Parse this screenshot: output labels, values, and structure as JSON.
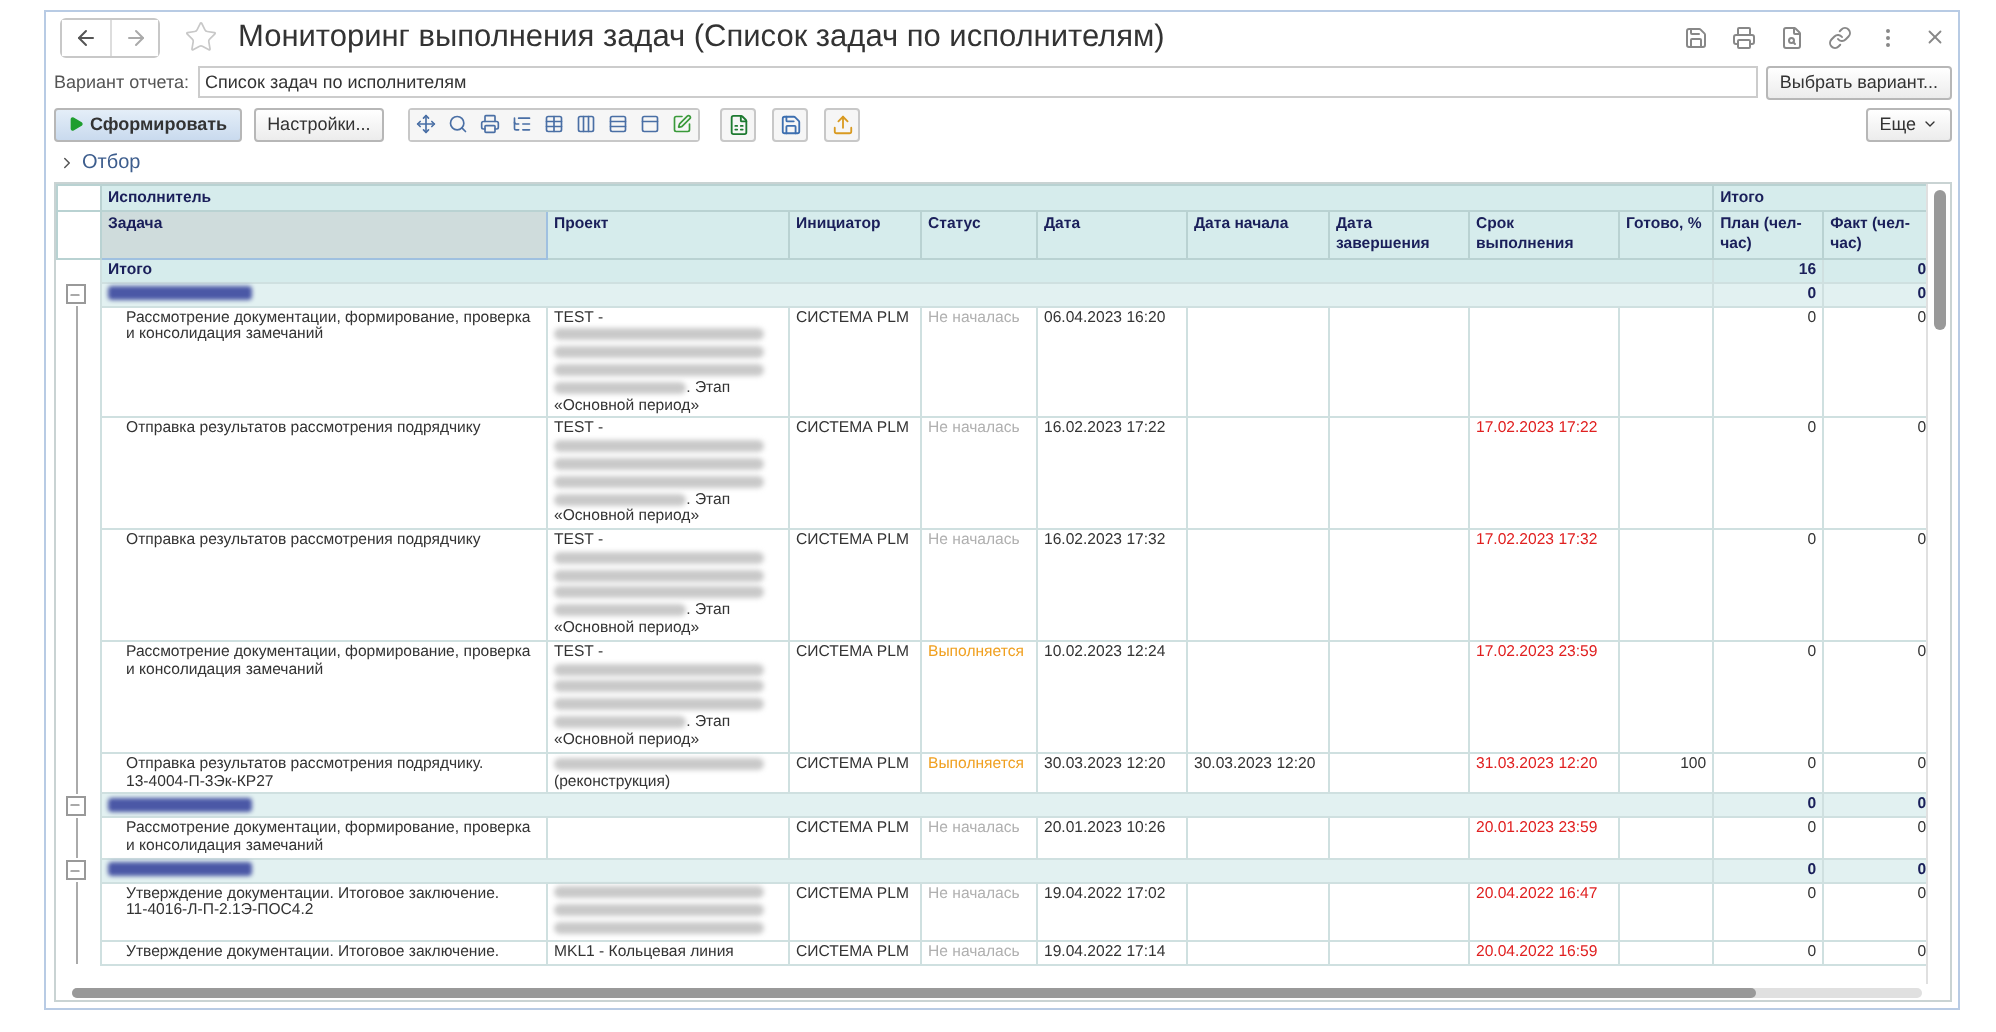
{
  "window": {
    "title": "Мониторинг выполнения задач (Список задач по исполнителям)"
  },
  "variant": {
    "label": "Вариант отчета:",
    "value": "Список задач по исполнителям",
    "button": "Выбрать вариант..."
  },
  "toolbar": {
    "generate": "Сформировать",
    "settings": "Настройки...",
    "more": "Еще"
  },
  "filter": {
    "label": "Отбор",
    "expanded": false
  },
  "table": {
    "group_header": "Исполнитель",
    "totals_header": "Итого",
    "columns": [
      "Задача",
      "Проект",
      "Инициатор",
      "Статус",
      "Дата",
      "Дата начала",
      "Дата завершения",
      "Срок выполнения",
      "Готово, %",
      "План (чел-час)",
      "Факт (чел-час)"
    ],
    "total": {
      "label": "Итого",
      "plan": "16",
      "fact": "0"
    },
    "rows": [
      {
        "kind": "group",
        "expanded": true,
        "plan": "0",
        "fact": "0"
      },
      {
        "kind": "task",
        "task": "Рассмотрение документации, формирование, проверка и консолидация замечаний",
        "project": [
          [
            {
              "kind": "text",
              "text": "TEST -"
            }
          ],
          [
            {
              "kind": "redacted"
            }
          ],
          [
            {
              "kind": "redacted"
            }
          ],
          [
            {
              "kind": "redacted"
            }
          ],
          [
            {
              "kind": "redacted"
            },
            {
              "kind": "text",
              "text": ". Этап"
            }
          ],
          [
            {
              "kind": "text",
              "text": "«Основной период»"
            }
          ]
        ],
        "initiator": "СИСТЕМА PLM",
        "status": {
          "kind": "not_started",
          "text": "Не началась"
        },
        "date": "06.04.2023 16:20",
        "plan": "0",
        "fact": "0"
      },
      {
        "kind": "task",
        "task": "Отправка результатов рассмотрения подрядчику",
        "project": [
          [
            {
              "kind": "text",
              "text": "TEST -"
            }
          ],
          [
            {
              "kind": "redacted"
            }
          ],
          [
            {
              "kind": "redacted"
            }
          ],
          [
            {
              "kind": "redacted"
            }
          ],
          [
            {
              "kind": "redacted"
            },
            {
              "kind": "text",
              "text": ". Этап"
            }
          ],
          [
            {
              "kind": "text",
              "text": "«Основной период»"
            }
          ]
        ],
        "initiator": "СИСТЕМА PLM",
        "status": {
          "kind": "not_started",
          "text": "Не началась"
        },
        "date": "16.02.2023 17:22",
        "deadline": {
          "text": "17.02.2023 17:22",
          "overdue": true
        },
        "plan": "0",
        "fact": "0"
      },
      {
        "kind": "task",
        "task": "Отправка результатов рассмотрения подрядчику",
        "project": [
          [
            {
              "kind": "text",
              "text": "TEST -"
            }
          ],
          [
            {
              "kind": "redacted"
            }
          ],
          [
            {
              "kind": "redacted"
            }
          ],
          [
            {
              "kind": "redacted"
            }
          ],
          [
            {
              "kind": "redacted"
            },
            {
              "kind": "text",
              "text": ". Этап"
            }
          ],
          [
            {
              "kind": "text",
              "text": "«Основной период»"
            }
          ]
        ],
        "initiator": "СИСТЕМА PLM",
        "status": {
          "kind": "not_started",
          "text": "Не началась"
        },
        "date": "16.02.2023 17:32",
        "deadline": {
          "text": "17.02.2023 17:32",
          "overdue": true
        },
        "plan": "0",
        "fact": "0"
      },
      {
        "kind": "task",
        "task": "Рассмотрение документации, формирование, проверка и консолидация замечаний",
        "project": [
          [
            {
              "kind": "text",
              "text": "TEST -"
            }
          ],
          [
            {
              "kind": "redacted"
            }
          ],
          [
            {
              "kind": "redacted"
            }
          ],
          [
            {
              "kind": "redacted"
            }
          ],
          [
            {
              "kind": "redacted"
            },
            {
              "kind": "text",
              "text": ". Этап"
            }
          ],
          [
            {
              "kind": "text",
              "text": "«Основной период»"
            }
          ]
        ],
        "initiator": "СИСТЕМА PLM",
        "status": {
          "kind": "in_progress",
          "text": "Выполняется"
        },
        "date": "10.02.2023 12:24",
        "deadline": {
          "text": "17.02.2023 23:59",
          "overdue": true
        },
        "plan": "0",
        "fact": "0"
      },
      {
        "kind": "task",
        "task": "Отправка результатов рассмотрения подрядчику.\n13-4004-П-3Эк-КР27",
        "project": [
          [
            {
              "kind": "redacted"
            }
          ],
          [
            {
              "kind": "text",
              "text": "(реконструкция)"
            }
          ]
        ],
        "initiator": "СИСТЕМА PLM",
        "status": {
          "kind": "in_progress",
          "text": "Выполняется"
        },
        "date": "30.03.2023 12:20",
        "start": "30.03.2023 12:20",
        "deadline": {
          "text": "31.03.2023 12:20",
          "overdue": true
        },
        "ready": "100",
        "plan": "0",
        "fact": "0"
      },
      {
        "kind": "group",
        "expanded": true,
        "plan": "0",
        "fact": "0"
      },
      {
        "kind": "task",
        "task": "Рассмотрение документации, формирование, проверка и консолидация замечаний",
        "initiator": "СИСТЕМА PLM",
        "status": {
          "kind": "not_started",
          "text": "Не началась"
        },
        "date": "20.01.2023 10:26",
        "deadline": {
          "text": "20.01.2023 23:59",
          "overdue": true
        },
        "plan": "0",
        "fact": "0"
      },
      {
        "kind": "group",
        "expanded": true,
        "plan": "0",
        "fact": "0"
      },
      {
        "kind": "task",
        "task": "Утверждение документации. Итоговое заключение.\n11-4016-Л-П-2.1Э-ПОС4.2",
        "project": [
          [
            {
              "kind": "redacted"
            }
          ],
          [
            {
              "kind": "redacted"
            }
          ],
          [
            {
              "kind": "redacted"
            }
          ]
        ],
        "initiator": "СИСТЕМА PLM",
        "status": {
          "kind": "not_started",
          "text": "Не началась"
        },
        "date": "19.04.2022 17:02",
        "deadline": {
          "text": "20.04.2022 16:47",
          "overdue": true
        },
        "plan": "0",
        "fact": "0"
      },
      {
        "kind": "task",
        "task": "Утверждение документации. Итоговое заключение.",
        "project": [
          [
            {
              "kind": "text",
              "text": "MKL1 - Кольцевая линия"
            }
          ]
        ],
        "initiator": "СИСТЕМА PLM",
        "status": {
          "kind": "not_started",
          "text": "Не началась"
        },
        "date": "19.04.2022 17:14",
        "deadline": {
          "text": "20.04.2022 16:59",
          "overdue": true
        },
        "plan": "0",
        "fact": "0"
      }
    ]
  }
}
